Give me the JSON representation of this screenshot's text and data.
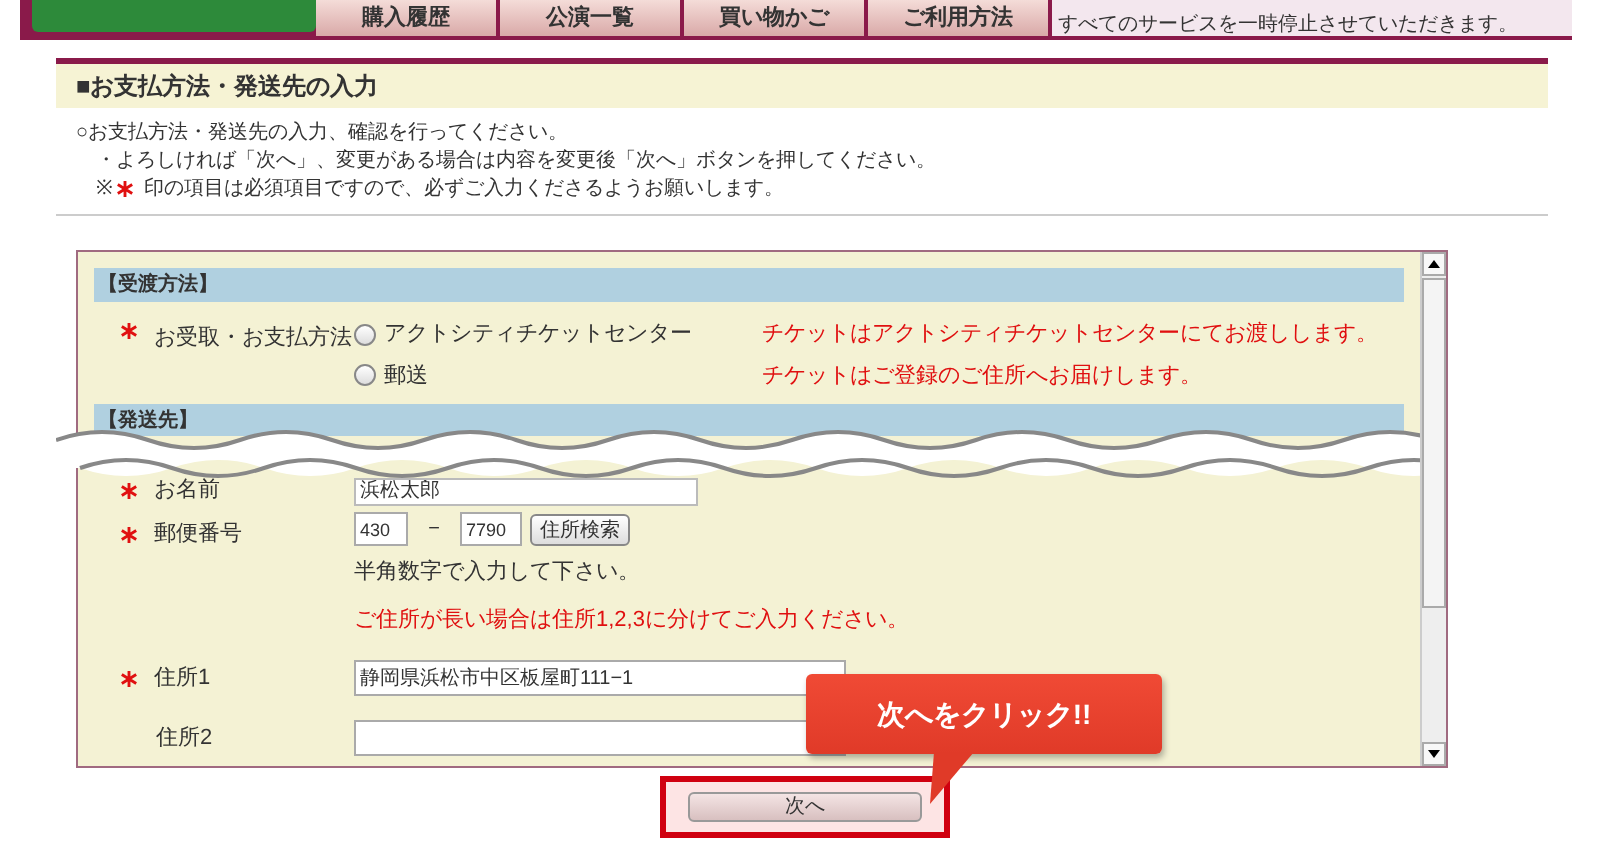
{
  "nav": {
    "tabs": [
      {
        "label": "購入履歴"
      },
      {
        "label": "公演一覧"
      },
      {
        "label": "買い物かご"
      },
      {
        "label": "ご利用方法"
      }
    ],
    "notice": "すべてのサービスを一時停止させていただきます。"
  },
  "page_title": "■お支払方法・発送先の入力",
  "intro": "○お支払方法・発送先の入力、確認を行ってください。",
  "note": "・よろしければ「次へ」、変更がある場合は内容を変更後「次へ」ボタンを押してください。",
  "required_note": {
    "prefix": "※",
    "text": "印の項目は必須項目ですので、必ずご入力くださるようお願いします。"
  },
  "receipt": {
    "heading": "【受渡方法】",
    "label": "お受取・お支払方法",
    "required": true,
    "options": [
      {
        "label": "アクトシティチケットセンター",
        "note": "チケットはアクトシティチケットセンターにてお渡しします。",
        "selected": false
      },
      {
        "label": "郵送",
        "note": "チケットはご登録のご住所へお届けします。",
        "selected": false
      }
    ]
  },
  "shipping": {
    "heading": "【発送先】",
    "name": {
      "label": "お名前",
      "required": true,
      "value": "浜松太郎"
    },
    "postal": {
      "label": "郵便番号",
      "required": true,
      "first": "430",
      "separator": "－",
      "second": "7790",
      "button": "住所検索",
      "hint": "半角数字で入力して下さい。",
      "warning": "ご住所が長い場合は住所1,2,3に分けてご入力ください。"
    },
    "address1": {
      "label": "住所1",
      "required": true,
      "value": "静岡県浜松市中区板屋町111−1"
    },
    "address2": {
      "label": "住所2",
      "required": false
    }
  },
  "callout": "次へをクリック!!",
  "next_button": "次へ"
}
